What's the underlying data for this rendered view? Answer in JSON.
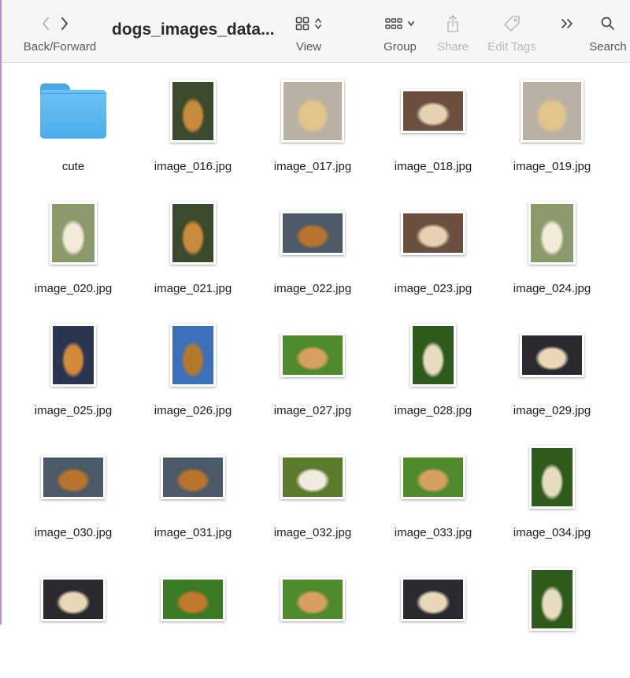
{
  "toolbar": {
    "back_forward_label": "Back/Forward",
    "title": "dogs_images_data...",
    "view_label": "View",
    "group_label": "Group",
    "share_label": "Share",
    "edit_tags_label": "Edit Tags",
    "search_label": "Search",
    "more_glyph": "»"
  },
  "files": [
    {
      "name": "cute",
      "kind": "folder"
    },
    {
      "name": "image_016.jpg",
      "kind": "image",
      "orient": "portrait",
      "scene": "forest"
    },
    {
      "name": "image_017.jpg",
      "kind": "image",
      "orient": "landscape-tall",
      "scene": "stone"
    },
    {
      "name": "image_018.jpg",
      "kind": "image",
      "orient": "landscape",
      "scene": "woods"
    },
    {
      "name": "image_019.jpg",
      "kind": "image",
      "orient": "landscape-tall",
      "scene": "stone"
    },
    {
      "name": "image_020.jpg",
      "kind": "image",
      "orient": "portrait-wide",
      "scene": "puppy"
    },
    {
      "name": "image_021.jpg",
      "kind": "image",
      "orient": "portrait",
      "scene": "forest"
    },
    {
      "name": "image_022.jpg",
      "kind": "image",
      "orient": "landscape",
      "scene": "road"
    },
    {
      "name": "image_023.jpg",
      "kind": "image",
      "orient": "landscape",
      "scene": "woods"
    },
    {
      "name": "image_024.jpg",
      "kind": "image",
      "orient": "portrait-wide",
      "scene": "puppy"
    },
    {
      "name": "image_025.jpg",
      "kind": "image",
      "orient": "portrait",
      "scene": "city"
    },
    {
      "name": "image_026.jpg",
      "kind": "image",
      "orient": "portrait",
      "scene": "sky"
    },
    {
      "name": "image_027.jpg",
      "kind": "image",
      "orient": "landscape",
      "scene": "grass"
    },
    {
      "name": "image_028.jpg",
      "kind": "image",
      "orient": "portrait",
      "scene": "green"
    },
    {
      "name": "image_029.jpg",
      "kind": "image",
      "orient": "landscape",
      "scene": "dark"
    },
    {
      "name": "image_030.jpg",
      "kind": "image",
      "orient": "landscape",
      "scene": "road"
    },
    {
      "name": "image_031.jpg",
      "kind": "image",
      "orient": "landscape",
      "scene": "road"
    },
    {
      "name": "image_032.jpg",
      "kind": "image",
      "orient": "landscape",
      "scene": "greenface"
    },
    {
      "name": "image_033.jpg",
      "kind": "image",
      "orient": "landscape",
      "scene": "grass"
    },
    {
      "name": "image_034.jpg",
      "kind": "image",
      "orient": "portrait",
      "scene": "green"
    },
    {
      "name": "",
      "kind": "image",
      "orient": "landscape",
      "scene": "dark"
    },
    {
      "name": "",
      "kind": "image",
      "orient": "landscape",
      "scene": "lawn"
    },
    {
      "name": "",
      "kind": "image",
      "orient": "landscape",
      "scene": "grass"
    },
    {
      "name": "",
      "kind": "image",
      "orient": "landscape",
      "scene": "dark"
    },
    {
      "name": "",
      "kind": "image",
      "orient": "portrait",
      "scene": "green"
    }
  ],
  "scenes": {
    "forest": [
      "#3b4a2c",
      "#c98a3a"
    ],
    "stone": [
      "#b9b1a4",
      "#e0c48a"
    ],
    "woods": [
      "#6b5040",
      "#e6d2b0"
    ],
    "puppy": [
      "#8a9a6a",
      "#f4ead8"
    ],
    "road": [
      "#4c5a68",
      "#b8742c"
    ],
    "city": [
      "#2a3550",
      "#d08a3a"
    ],
    "sky": [
      "#3c70b8",
      "#b4782c"
    ],
    "grass": [
      "#4f8a2c",
      "#d8a060"
    ],
    "green": [
      "#2e5a1c",
      "#e8dcc0"
    ],
    "dark": [
      "#2a2a2e",
      "#e8d8b8"
    ],
    "greenface": [
      "#5c7a2c",
      "#f2ece0"
    ],
    "lawn": [
      "#3a7a22",
      "#c0782a"
    ]
  }
}
